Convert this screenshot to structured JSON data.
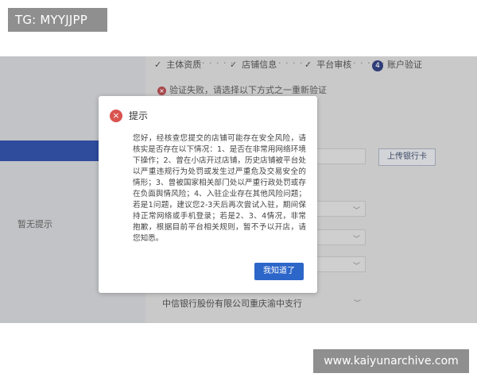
{
  "overlay_tag": "TG: MYYJJPP",
  "watermark": "www.kaiyunarchive.com",
  "sidebar": {
    "empty_tip": "暂无提示"
  },
  "steps": [
    {
      "label": "主体资质",
      "state": "done"
    },
    {
      "label": "店铺信息",
      "state": "done"
    },
    {
      "label": "平台审核",
      "state": "done"
    },
    {
      "label": "账户验证",
      "state": "current",
      "number": "4"
    }
  ],
  "step_check_glyph": "✓",
  "error_message": "验证失败，请选择以下方式之一重新验证",
  "upload_button_label": "上传银行卡",
  "bank_name": "中信银行股份有限公司重庆渝中支行",
  "modal": {
    "title": "提示",
    "body": "您好，经核查您提交的店铺可能存在安全风险，请核实是否存在以下情况：1、是否在非常用网络环境下操作；2、曾在小店开过店铺，历史店铺被平台处以严重违规行为处罚或发生过严重危及交易安全的情形；3、曾被国家相关部门处以严重行政处罚或存在负面舆情风险；4、入驻企业存在其他风险问题；若是1问题，建议您2-3天后再次尝试入驻，期间保持正常网络或手机登录；若是2、3、4情况，非常抱歉，根据目前平台相关规则，暂不予以开店，请您知悉。",
    "confirm_label": "我知道了"
  },
  "colors": {
    "primary_button": "#2d66c9",
    "warning_icon": "#d9534f",
    "step_current": "#2f3e78",
    "sidebar_accent": "#2f4b9c",
    "overlay_dim": "#c9c9c9"
  },
  "icons": {
    "modal_warning": "close-circle-icon",
    "error_status": "error-circle-icon",
    "step_done": "check-icon",
    "select": "chevron-down-icon"
  }
}
